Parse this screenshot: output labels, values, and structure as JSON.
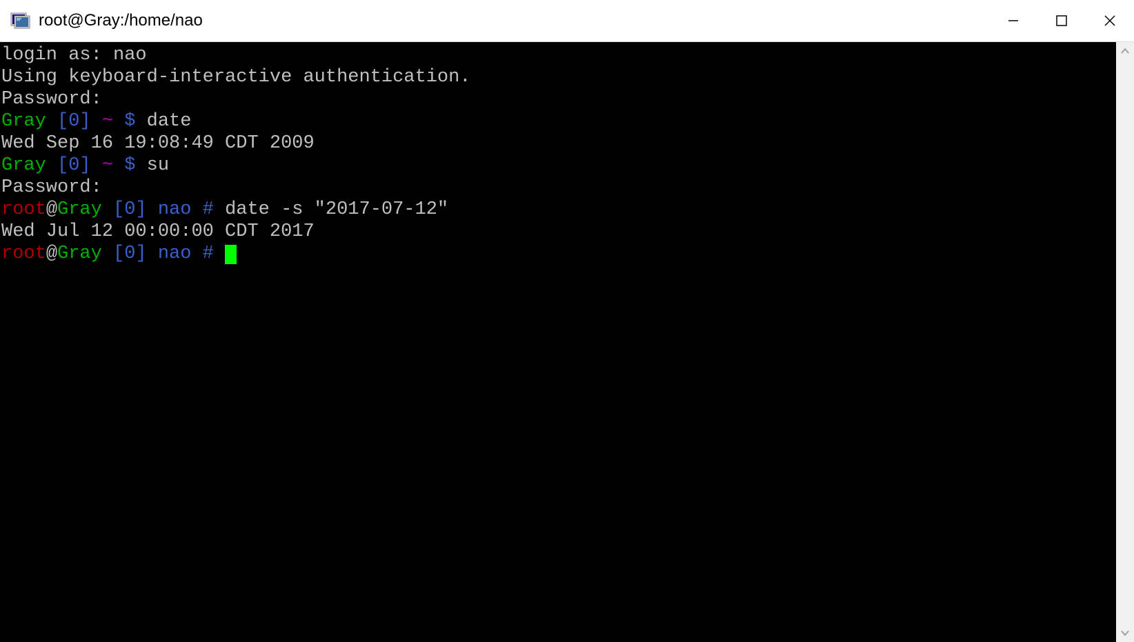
{
  "window": {
    "title": "root@Gray:/home/nao"
  },
  "terminal": {
    "lines": {
      "login_as": "login as: nao",
      "auth_method": "Using keyboard-interactive authentication.",
      "password1": "Password:",
      "prompt1_host": "Gray",
      "prompt1_bracket": " [0] ",
      "prompt1_tilde": "~",
      "prompt1_dollar": " $ ",
      "cmd1": "date",
      "out1": "Wed Sep 16 19:08:49 CDT 2009",
      "prompt2_host": "Gray",
      "prompt2_bracket": " [0] ",
      "prompt2_tilde": "~",
      "prompt2_dollar": " $ ",
      "cmd2": "su",
      "password2": "Password:",
      "rootprompt1_user": "root",
      "rootprompt1_at": "@",
      "rootprompt1_host": "Gray",
      "rootprompt1_bracket": " [0] ",
      "rootprompt1_dir": "nao",
      "rootprompt1_hash": " # ",
      "cmd3": "date -s \"2017-07-12\"",
      "out2": "Wed Jul 12 00:00:00 CDT 2017",
      "rootprompt2_user": "root",
      "rootprompt2_at": "@",
      "rootprompt2_host": "Gray",
      "rootprompt2_bracket": " [0] ",
      "rootprompt2_dir": "nao",
      "rootprompt2_hash": " # "
    }
  }
}
